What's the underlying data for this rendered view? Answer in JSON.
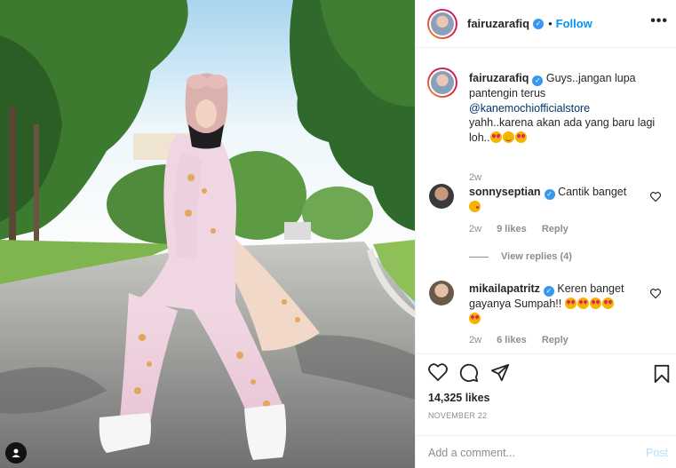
{
  "header": {
    "username": "fairuzarafiq",
    "separator": "•",
    "follow_label": "Follow",
    "more_icon": "•••"
  },
  "caption": {
    "username": "fairuzarafiq",
    "text_before": "Guys..jangan lupa pantengin terus",
    "mention": "@kanemochiofficialstore",
    "text_after": "yahh..karena akan ada yang baru lagi loh..",
    "emojis": [
      "love-eyes-face",
      "hugging-face",
      "love-eyes-face"
    ],
    "time": "2w"
  },
  "comments": [
    {
      "username": "sonnyseptian",
      "text": "Cantik banget",
      "emojis": [
        "kissing-face"
      ],
      "time": "2w",
      "likes": "9 likes",
      "reply": "Reply",
      "view_replies": "View replies (4)"
    },
    {
      "username": "mikailapatritz",
      "text": "Keren banget gayanya Sumpah!!",
      "emojis": [
        "love-eyes-face",
        "love-eyes-face",
        "love-eyes-face",
        "love-eyes-face",
        "love-eyes-face"
      ],
      "time": "2w",
      "likes": "6 likes",
      "reply": "Reply"
    }
  ],
  "actions": {
    "likes_count": "14,325 likes",
    "date": "NOVEMBER 22"
  },
  "add_comment": {
    "placeholder": "Add a comment...",
    "post_label": "Post"
  },
  "colors": {
    "link_blue": "#0095f6",
    "verified_blue": "#3897f0",
    "muted_text": "#8e8e8e",
    "border": "#efefef"
  }
}
